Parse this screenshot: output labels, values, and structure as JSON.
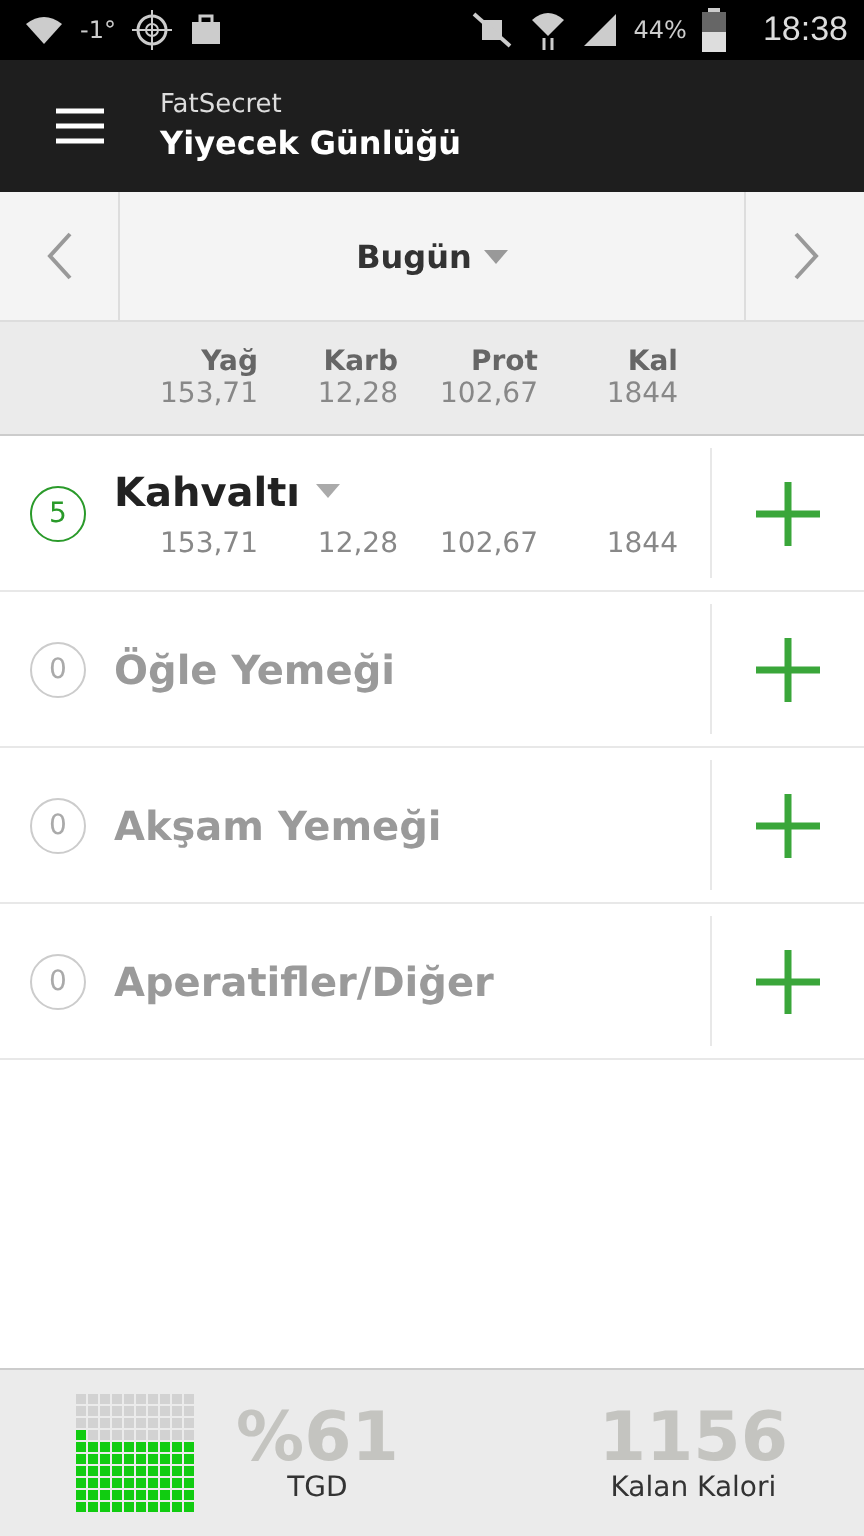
{
  "status_bar": {
    "temperature": "-1°",
    "battery": "44%",
    "time": "18:38"
  },
  "app_bar": {
    "app_name": "FatSecret",
    "title": "Yiyecek Günlüğü"
  },
  "date_nav": {
    "label": "Bugün"
  },
  "totals": {
    "columns": [
      {
        "label": "Yağ",
        "value": "153,71"
      },
      {
        "label": "Karb",
        "value": "12,28"
      },
      {
        "label": "Prot",
        "value": "102,67"
      },
      {
        "label": "Kal",
        "value": "1844"
      }
    ]
  },
  "meals": [
    {
      "name": "Kahvaltı",
      "count": "5",
      "active": true,
      "values": [
        "153,71",
        "12,28",
        "102,67",
        "1844"
      ]
    },
    {
      "name": "Öğle Yemeği",
      "count": "0",
      "active": false
    },
    {
      "name": "Akşam Yemeği",
      "count": "0",
      "active": false
    },
    {
      "name": "Aperatifler/Diğer",
      "count": "0",
      "active": false
    }
  ],
  "summary": {
    "percent": "%61",
    "percent_label": "TGD",
    "remaining": "1156",
    "remaining_label": "Kalan Kalori"
  }
}
